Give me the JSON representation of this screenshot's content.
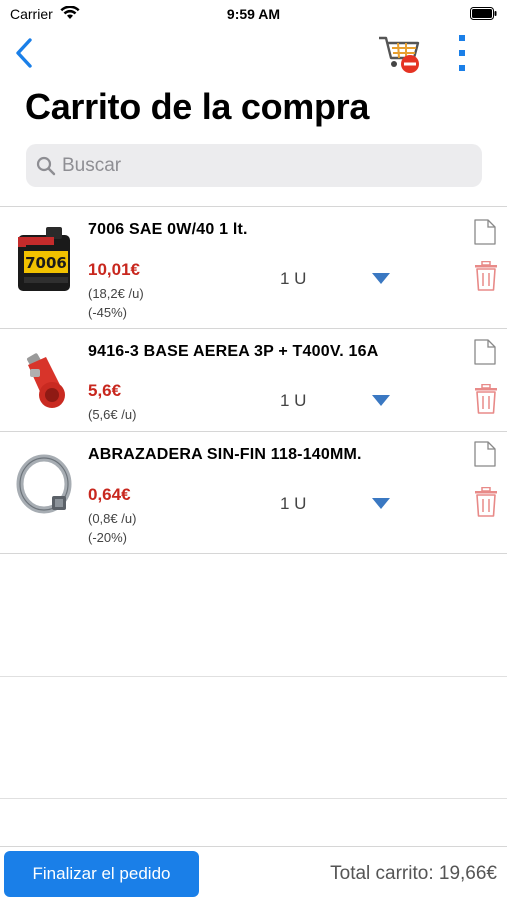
{
  "status_bar": {
    "carrier": "Carrier",
    "time": "9:59 AM"
  },
  "title": "Carrito de la compra",
  "search": {
    "placeholder": "Buscar",
    "value": ""
  },
  "items": [
    {
      "name": "7006 SAE 0W/40 1 lt.",
      "price": "10,01€",
      "unit_price": "(18,2€ /u)",
      "discount": "(-45%)",
      "quantity": "1 U",
      "image_icon": "oil-bottle",
      "image_label": "7006"
    },
    {
      "name": "9416-3 BASE AEREA 3P + T400V. 16A",
      "price": "5,6€",
      "unit_price": "(5,6€ /u)",
      "discount": "",
      "quantity": "1 U",
      "image_icon": "red-plug"
    },
    {
      "name": "ABRAZADERA SIN-FIN 118-140MM.",
      "price": "0,64€",
      "unit_price": "(0,8€ /u)",
      "discount": "(-20%)",
      "quantity": "1 U",
      "image_icon": "hose-clamp"
    }
  ],
  "footer": {
    "finish_label": "Finalizar el pedido",
    "total": "Total carrito: 19,66€"
  },
  "colors": {
    "accent": "#1a7fe8",
    "price": "#c8271e",
    "trash": "#e88a88"
  }
}
